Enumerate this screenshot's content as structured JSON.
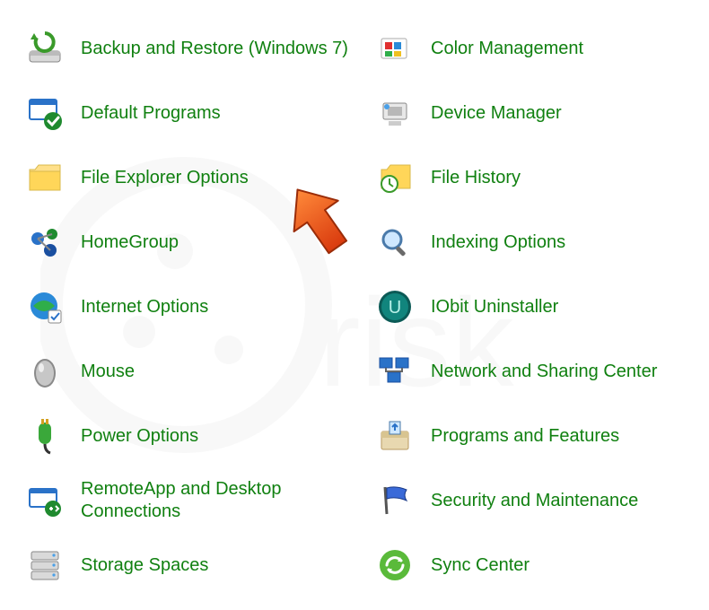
{
  "items_left": [
    {
      "id": "backup-restore",
      "icon": "backup-restore-icon",
      "label": "Backup and Restore (Windows 7)"
    },
    {
      "id": "default-programs",
      "icon": "default-programs-icon",
      "label": "Default Programs"
    },
    {
      "id": "file-explorer-options",
      "icon": "folder-icon",
      "label": "File Explorer Options"
    },
    {
      "id": "homegroup",
      "icon": "homegroup-icon",
      "label": "HomeGroup"
    },
    {
      "id": "internet-options",
      "icon": "internet-options-icon",
      "label": "Internet Options"
    },
    {
      "id": "mouse",
      "icon": "mouse-icon",
      "label": "Mouse"
    },
    {
      "id": "power-options",
      "icon": "power-options-icon",
      "label": "Power Options"
    },
    {
      "id": "remoteapp",
      "icon": "remoteapp-icon",
      "label": "RemoteApp and Desktop Connections"
    },
    {
      "id": "storage-spaces",
      "icon": "storage-icon",
      "label": "Storage Spaces"
    }
  ],
  "items_right": [
    {
      "id": "color-management",
      "icon": "color-management-icon",
      "label": "Color Management"
    },
    {
      "id": "device-manager",
      "icon": "device-manager-icon",
      "label": "Device Manager"
    },
    {
      "id": "file-history",
      "icon": "file-history-icon",
      "label": "File History"
    },
    {
      "id": "indexing-options",
      "icon": "indexing-icon",
      "label": "Indexing Options"
    },
    {
      "id": "iobit-uninstaller",
      "icon": "iobit-icon",
      "label": "IObit Uninstaller"
    },
    {
      "id": "network-sharing",
      "icon": "network-sharing-icon",
      "label": "Network and Sharing Center"
    },
    {
      "id": "programs-features",
      "icon": "programs-features-icon",
      "label": "Programs and Features"
    },
    {
      "id": "security-maintenance",
      "icon": "security-flag-icon",
      "label": "Security and Maintenance"
    },
    {
      "id": "sync-center",
      "icon": "sync-center-icon",
      "label": "Sync Center"
    }
  ],
  "highlight_arrow_target": "file-explorer-options",
  "colors": {
    "link": "#108010",
    "arrow": "#e95a20"
  }
}
